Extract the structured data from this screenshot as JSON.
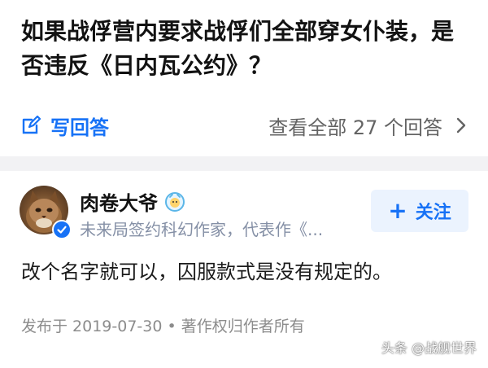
{
  "question": {
    "title": "如果战俘营内要求战俘们全部穿女仆装，是否违反《日内瓦公约》？",
    "write_answer_label": "写回答",
    "view_all_label": "查看全部 27 个回答"
  },
  "answer": {
    "author_name": "肉卷大爷",
    "author_bio": "未来局签约科幻作家，代表作《...",
    "follow_label": "关注",
    "content": "改个名字就可以，囚服款式是没有规定的。",
    "meta": "发布于 2019-07-30 • 著作权归作者所有"
  },
  "watermark": "头条 @战舰世界",
  "colors": {
    "accent": "#1772f6",
    "divider": "#f2f2f4",
    "secondary_text": "#8590a6"
  },
  "icons": [
    "edit-icon",
    "chevron-right-icon",
    "verified-icon",
    "avatar-badge-icon",
    "plus-icon"
  ]
}
